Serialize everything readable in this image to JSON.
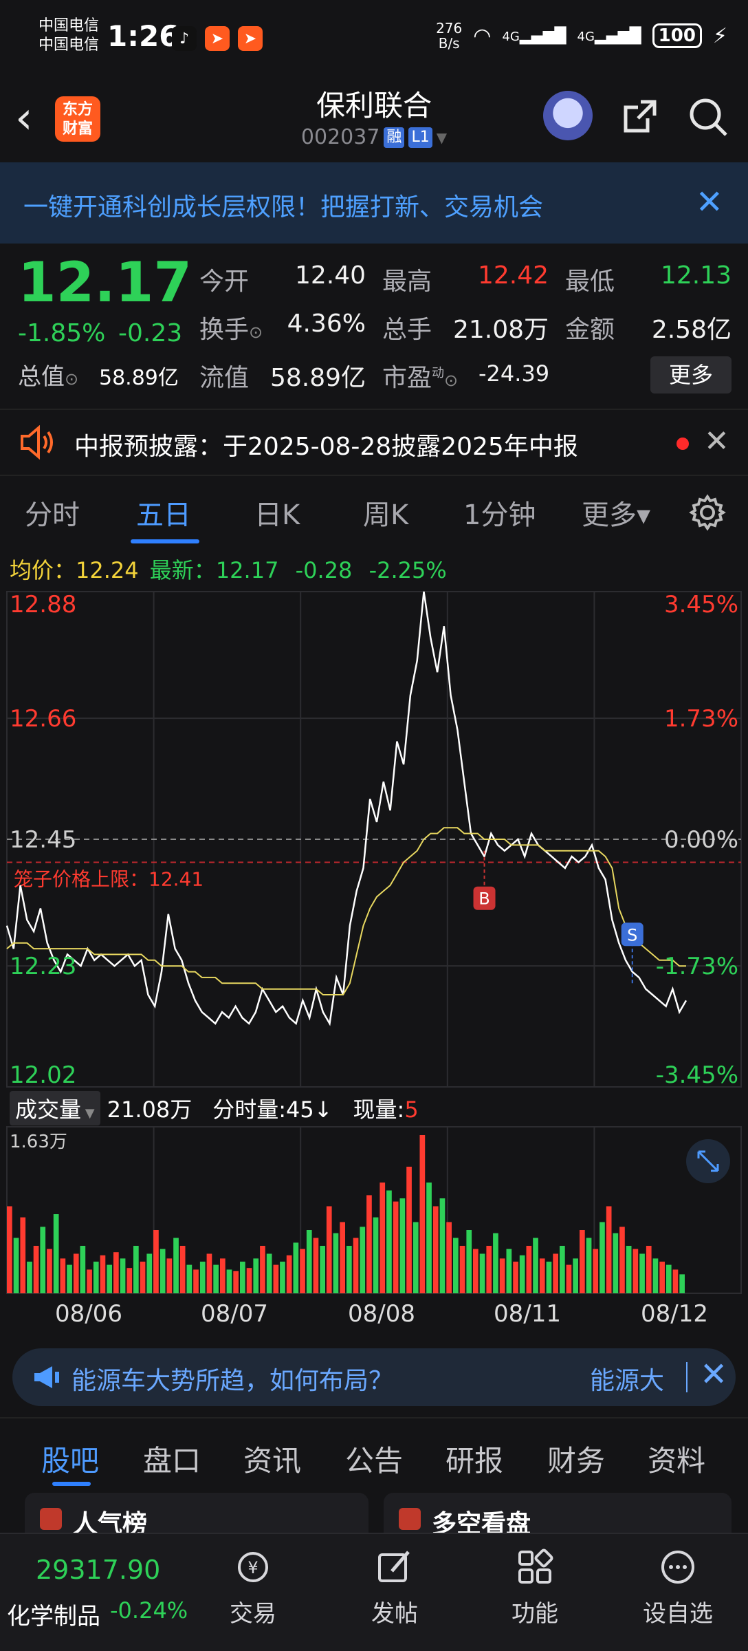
{
  "status_bar": {
    "carrier1": "中国电信",
    "carrier2": "中国电信",
    "time": "1:26",
    "net_speed_top": "276",
    "net_speed_bottom": "B/s",
    "signal1": "4G",
    "signal2": "4G",
    "battery": "100"
  },
  "header": {
    "logo_line1": "东方",
    "logo_line2": "财富",
    "stock_name": "保利联合",
    "stock_code": "002037",
    "tag_margin": "融",
    "tag_level": "L1"
  },
  "promo": {
    "text": "一键开通科创成长层权限！把握打新、交易机会",
    "close": "✕"
  },
  "quote": {
    "price": "12.17",
    "change_pct": "-1.85%",
    "change_amt": "-0.23",
    "market_cap_label": "总值",
    "market_cap_value": "58.89亿",
    "open_label": "今开",
    "open_value": "12.40",
    "high_label": "最高",
    "high_value": "12.42",
    "low_label": "最低",
    "low_value": "12.13",
    "turnover_label": "换手",
    "turnover_value": "4.36%",
    "volume_label": "总手",
    "volume_value": "21.08万",
    "amount_label": "金额",
    "amount_value": "2.58亿",
    "float_cap_label": "流值",
    "float_cap_value": "58.89亿",
    "pe_label": "市盈",
    "pe_sup": "动",
    "pe_value": "-24.39",
    "more_button": "更多"
  },
  "notice": {
    "text": "中报预披露：于2025-08-28披露2025年中报"
  },
  "chart_tabs": [
    "分时",
    "五日",
    "日K",
    "周K",
    "1分钟",
    "更多▾"
  ],
  "info_row": {
    "avg_label": "均价：",
    "avg_value": "12.24",
    "latest_label": "最新：",
    "latest_value": "12.17",
    "latest_change": "-0.28",
    "latest_pct": "-2.25%"
  },
  "chart_data": {
    "type": "line",
    "title": "",
    "x_days": [
      "08/06",
      "08/07",
      "08/08",
      "08/11",
      "08/12"
    ],
    "ylim": [
      12.02,
      12.88
    ],
    "y_tick_labels": [
      "12.88",
      "12.66",
      "12.45",
      "12.23",
      "12.02"
    ],
    "right_tick_labels": [
      "3.45%",
      "1.73%",
      "0.00%",
      "-1.73%",
      "-3.45%"
    ],
    "reference_price": 12.45,
    "limit_line_label": "笼子价格上限：12.41",
    "limit_line_value": 12.41,
    "markers": [
      {
        "label": "B",
        "price": 12.43
      },
      {
        "label": "S",
        "price": 12.2
      }
    ],
    "series": [
      {
        "name": "",
        "color": "#ffffff",
        "values": [
          12.3,
          12.26,
          12.37,
          12.31,
          12.29,
          12.33,
          12.27,
          12.24,
          12.22,
          12.25,
          12.24,
          12.23,
          12.26,
          12.24,
          12.25,
          12.24,
          12.23,
          12.24,
          12.25,
          12.23,
          12.24,
          12.18,
          12.16,
          12.22,
          12.32,
          12.26,
          12.24,
          12.2,
          12.17,
          12.15,
          12.14,
          12.13,
          12.15,
          12.14,
          12.16,
          12.14,
          12.13,
          12.15,
          12.19,
          12.17,
          12.15,
          12.16,
          12.14,
          12.13,
          12.17,
          12.14,
          12.19,
          12.15,
          12.13,
          12.21,
          12.18,
          12.3,
          12.36,
          12.4,
          12.52,
          12.48,
          12.55,
          12.5,
          12.62,
          12.58,
          12.7,
          12.76,
          12.88,
          12.8,
          12.74,
          12.82,
          12.7,
          12.64,
          12.55,
          12.46,
          12.44,
          12.42,
          12.46,
          12.44,
          12.43,
          12.44,
          12.45,
          12.42,
          12.46,
          12.44,
          12.43,
          12.42,
          12.41,
          12.4,
          12.42,
          12.41,
          12.42,
          12.44,
          12.4,
          12.38,
          12.31,
          12.27,
          12.24,
          12.22,
          12.21,
          12.19,
          12.18,
          12.17,
          12.16,
          12.19,
          12.15,
          12.17
        ]
      },
      {
        "name": "",
        "color": "#e8d860",
        "values": [
          12.26,
          12.27,
          12.27,
          12.27,
          12.26,
          12.26,
          12.26,
          12.26,
          12.26,
          12.26,
          12.26,
          12.26,
          12.26,
          12.25,
          12.25,
          12.25,
          12.25,
          12.25,
          12.25,
          12.25,
          12.25,
          12.24,
          12.24,
          12.23,
          12.23,
          12.23,
          12.23,
          12.22,
          12.22,
          12.21,
          12.21,
          12.21,
          12.2,
          12.2,
          12.2,
          12.2,
          12.2,
          12.2,
          12.19,
          12.19,
          12.19,
          12.19,
          12.19,
          12.19,
          12.19,
          12.19,
          12.19,
          12.18,
          12.18,
          12.18,
          12.18,
          12.2,
          12.25,
          12.3,
          12.33,
          12.35,
          12.36,
          12.37,
          12.39,
          12.41,
          12.42,
          12.43,
          12.45,
          12.46,
          12.46,
          12.47,
          12.47,
          12.47,
          12.46,
          12.46,
          12.46,
          12.45,
          12.45,
          12.45,
          12.45,
          12.44,
          12.44,
          12.44,
          12.44,
          12.44,
          12.43,
          12.43,
          12.43,
          12.43,
          12.43,
          12.43,
          12.43,
          12.43,
          12.43,
          12.42,
          12.4,
          12.33,
          12.3,
          12.28,
          12.27,
          12.26,
          12.25,
          12.24,
          12.24,
          12.24,
          12.23,
          12.23
        ]
      }
    ],
    "volume": {
      "max_label": "1.63万",
      "values": [
        0.55,
        0.35,
        0.48,
        0.2,
        0.3,
        0.42,
        0.28,
        0.5,
        0.22,
        0.18,
        0.25,
        0.3,
        0.15,
        0.2,
        0.24,
        0.18,
        0.26,
        0.22,
        0.16,
        0.3,
        0.2,
        0.25,
        0.4,
        0.28,
        0.22,
        0.35,
        0.3,
        0.18,
        0.15,
        0.2,
        0.25,
        0.18,
        0.22,
        0.15,
        0.14,
        0.2,
        0.16,
        0.22,
        0.3,
        0.25,
        0.18,
        0.2,
        0.24,
        0.32,
        0.28,
        0.4,
        0.35,
        0.3,
        0.55,
        0.38,
        0.45,
        0.3,
        0.35,
        0.42,
        0.62,
        0.48,
        0.7,
        0.65,
        0.58,
        0.6,
        0.8,
        0.45,
        1.0,
        0.7,
        0.55,
        0.6,
        0.45,
        0.35,
        0.3,
        0.4,
        0.28,
        0.25,
        0.3,
        0.38,
        0.22,
        0.28,
        0.2,
        0.24,
        0.3,
        0.35,
        0.22,
        0.2,
        0.25,
        0.3,
        0.18,
        0.22,
        0.4,
        0.35,
        0.28,
        0.45,
        0.55,
        0.38,
        0.42,
        0.3,
        0.28,
        0.25,
        0.3,
        0.22,
        0.2,
        0.18,
        0.15,
        0.12
      ],
      "colors": [
        "#ff3b30",
        "#2ed158"
      ]
    }
  },
  "volume_row": {
    "dropdown": "成交量",
    "total": "21.08万",
    "per_trade_label": "分时量:45↓",
    "current_label": "现量:",
    "current_value": "5"
  },
  "ad": {
    "text": "能源车大势所趋，如何布局？",
    "text2": "能源大"
  },
  "bottom_tabs": [
    "股吧",
    "盘口",
    "资讯",
    "公告",
    "研报",
    "财务",
    "资料"
  ],
  "cards": [
    "人气榜",
    "多空看盘"
  ],
  "bottom_nav": {
    "index_value": "29317.90",
    "index_name": "化学制品",
    "index_pct": "-0.24%",
    "items": [
      "交易",
      "发帖",
      "功能",
      "设自选"
    ]
  }
}
